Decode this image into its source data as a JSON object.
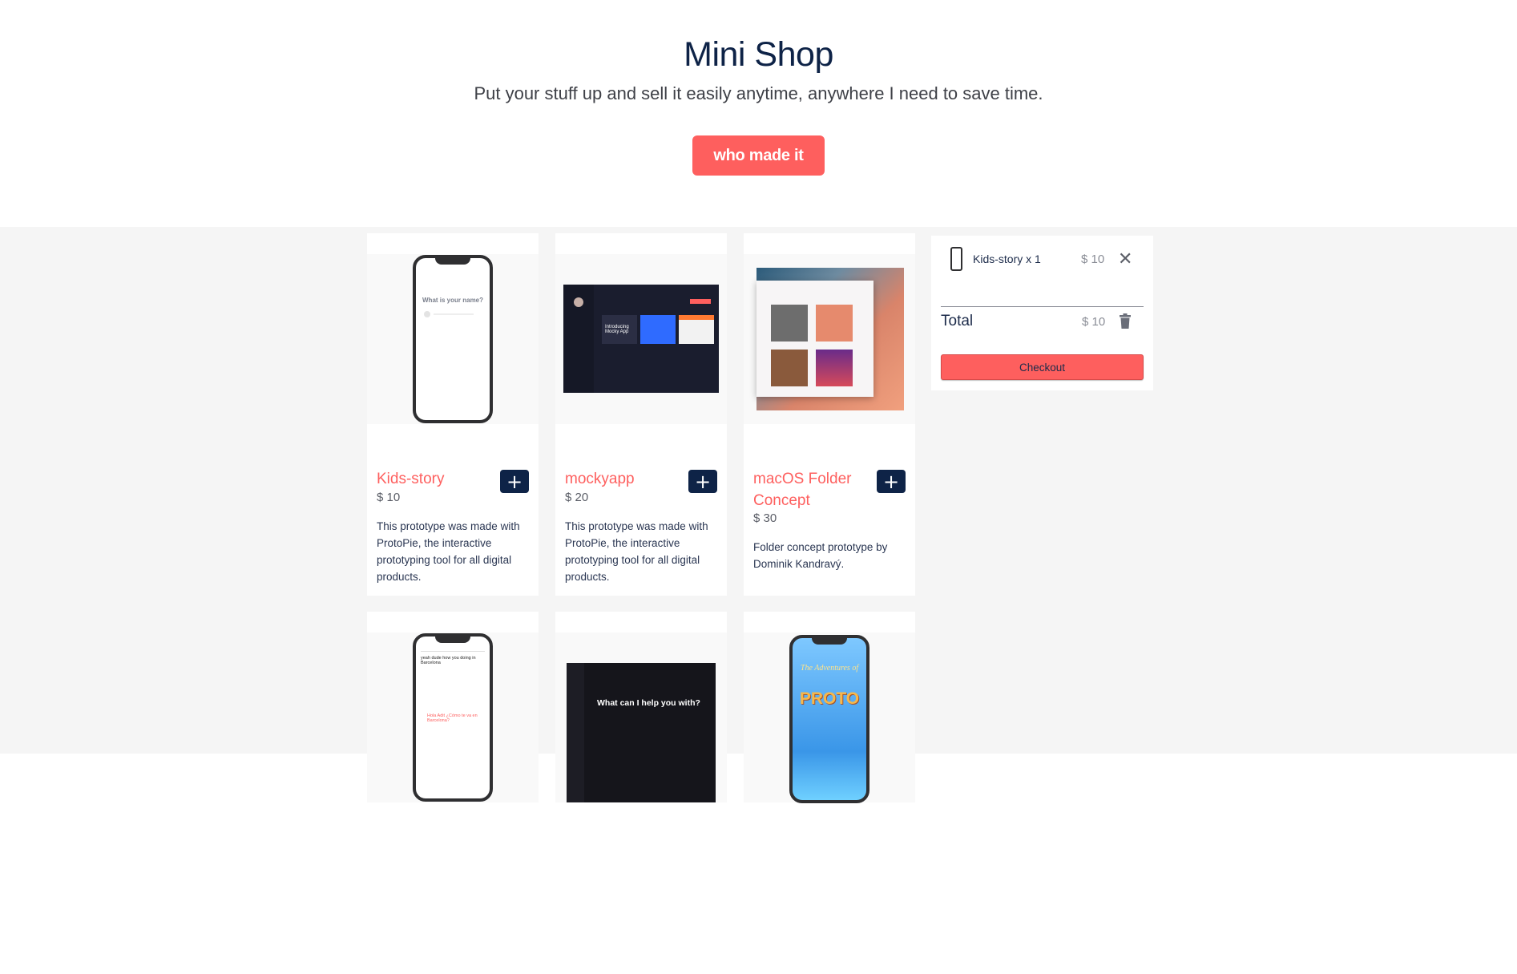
{
  "hero": {
    "title": "Mini Shop",
    "subtitle": "Put your stuff up and sell it easily anytime, anywhere I need to save time.",
    "button_label": "who made it"
  },
  "products": [
    {
      "name": "Kids-story",
      "price": "$ 10",
      "description": "This prototype was made with ProtoPie, the interactive prototyping tool for all digital products.",
      "image_text": [
        "What is your name?"
      ],
      "add_label": "+"
    },
    {
      "name": "mockyapp",
      "price": "$ 20",
      "description": "This prototype was made with ProtoPie, the interactive prototyping tool for all digital products.",
      "image_text": [
        "Introducing",
        "Mocky App"
      ],
      "add_label": "+"
    },
    {
      "name": "macOS Folder Concept",
      "price": "$ 30",
      "description": "Folder concept prototype by Dominik Kandravý.",
      "image_text": [],
      "add_label": "+"
    },
    {
      "name": "",
      "price": "",
      "description": "",
      "image_text": [
        "yeah dude how you doing in Barcelona",
        "Hola Adit ¿Cómo te va en Barcelona?"
      ],
      "add_label": "+"
    },
    {
      "name": "",
      "price": "",
      "description": "",
      "image_text": [
        "What can I help you with?"
      ],
      "add_label": "+"
    },
    {
      "name": "",
      "price": "",
      "description": "",
      "image_text": [
        "The Adventures of",
        "PROTO"
      ],
      "add_label": "+"
    }
  ],
  "cart": {
    "item_label": "Kids-story x 1",
    "item_price": "$ 10",
    "remove_icon": "close-icon",
    "total_label": "Total",
    "total_value": "$ 10",
    "clear_icon": "trash-icon",
    "checkout_label": "Checkout"
  },
  "colors": {
    "accent": "#fe5f5e",
    "navy": "#0e2347",
    "background": "#f5f5f5"
  }
}
